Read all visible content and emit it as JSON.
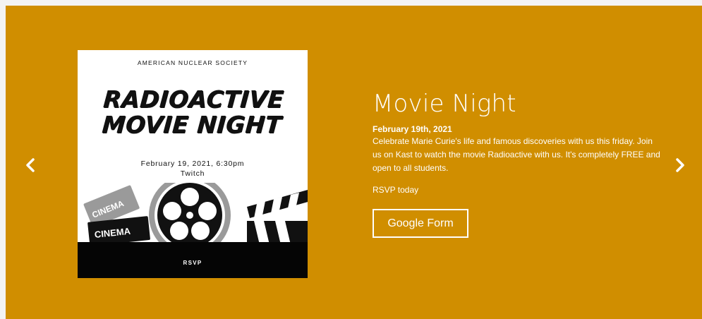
{
  "carousel": {
    "prev_icon": "chevron-left-icon",
    "next_icon": "chevron-right-icon",
    "background": "#d08e00"
  },
  "poster": {
    "org": "AMERICAN NUCLEAR SOCIETY",
    "title_line1": "RADIOACTIVE",
    "title_line2": "MOVIE NIGHT",
    "date": "February 19, 2021,  6:30pm",
    "platform": "Twitch",
    "ticket_text1": "CINEMA",
    "ticket_text2": "CINEMA",
    "rsvp": "RSVP"
  },
  "slide": {
    "title": "Movie Night",
    "date": "February 19th, 2021",
    "description": "Celebrate Marie Curie's life and famous discoveries with us this friday. Join us on Kast to watch the movie Radioactive with us. It's completely FREE and open to all students.",
    "rsvp_text": "RSVP today",
    "button_label": "Google Form"
  }
}
